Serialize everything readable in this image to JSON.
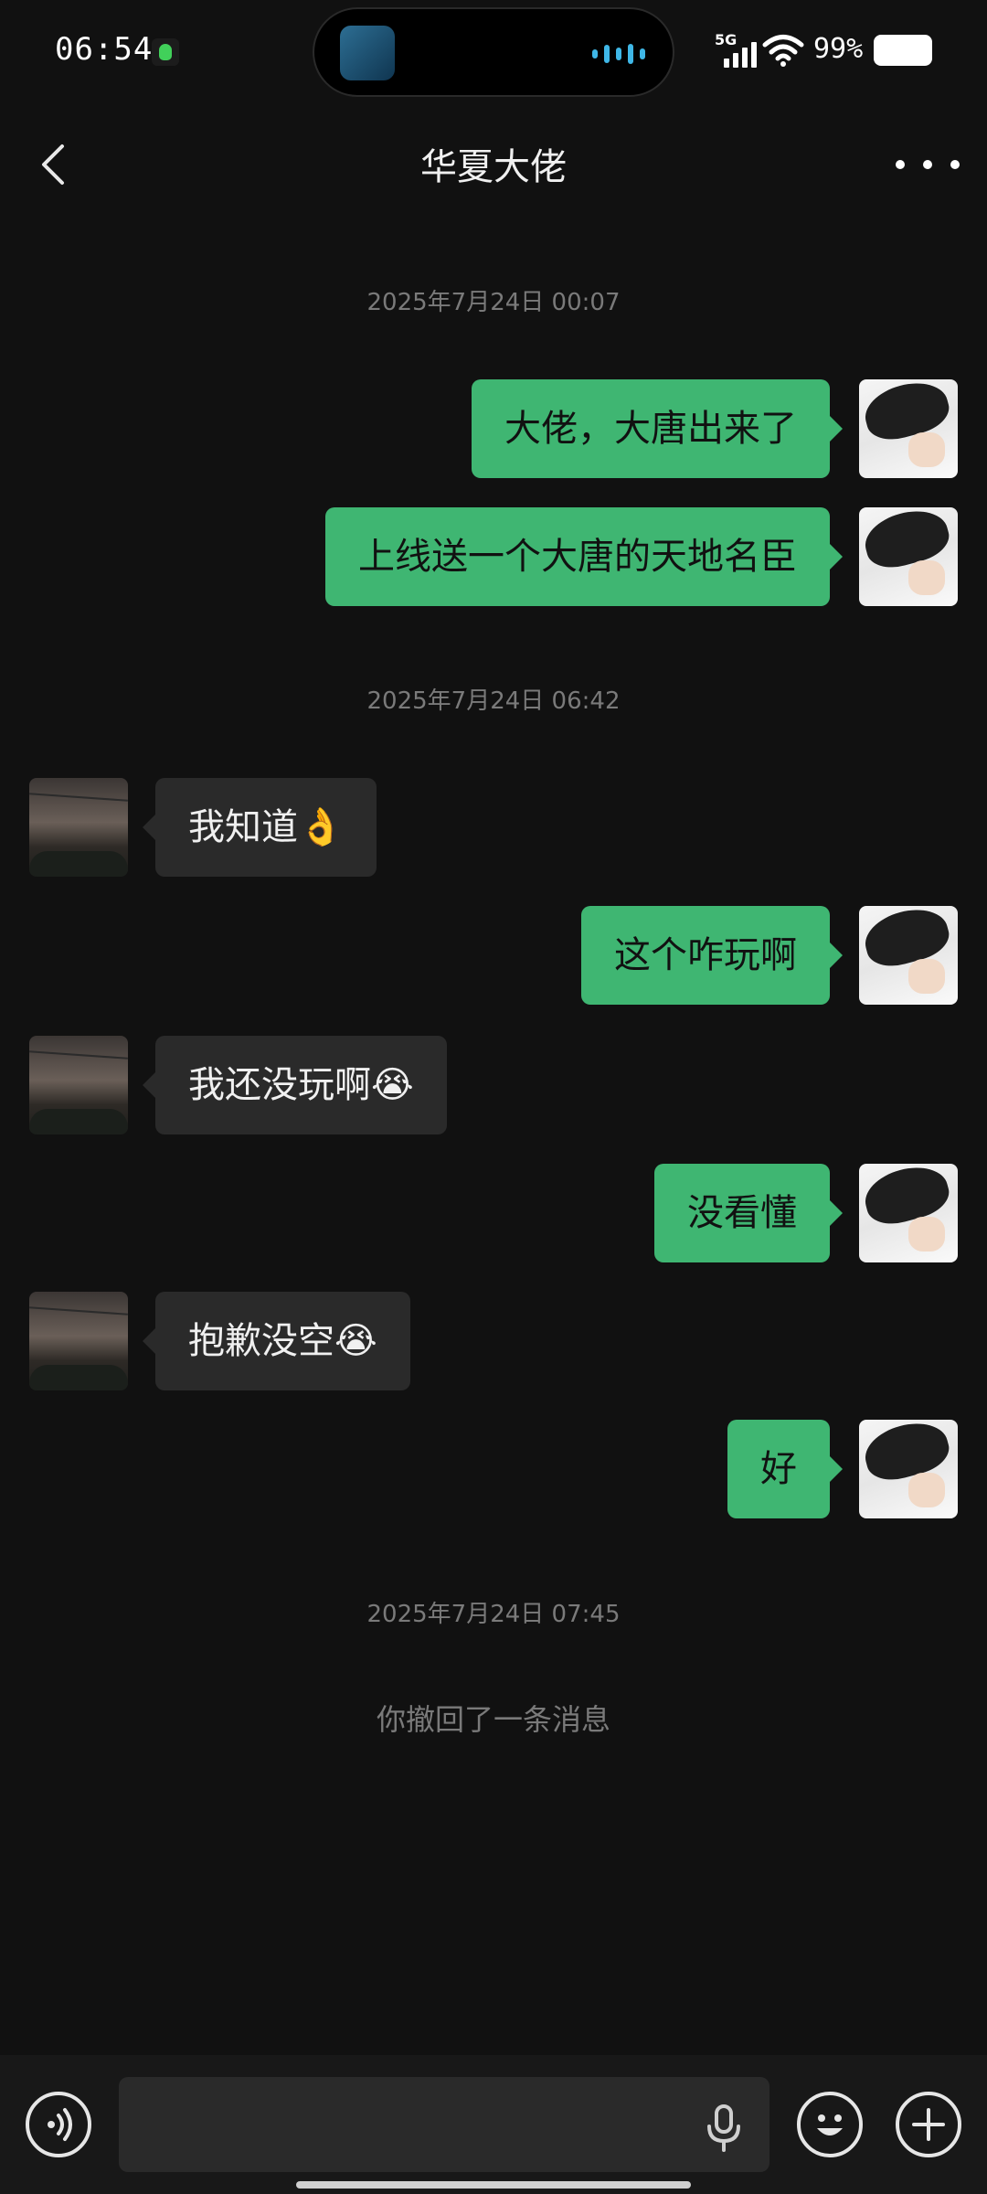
{
  "status_bar": {
    "time": "06:54",
    "network": "5G",
    "battery_percent": "99%"
  },
  "header": {
    "title": "华夏大佬"
  },
  "messages": [
    {
      "type": "timestamp",
      "text": "2025年7月24日 00:07"
    },
    {
      "type": "message",
      "from": "me",
      "text": "大佬，大唐出来了"
    },
    {
      "type": "message",
      "from": "me",
      "text": "上线送一个大唐的天地名臣"
    },
    {
      "type": "timestamp",
      "text": "2025年7月24日 06:42"
    },
    {
      "type": "message",
      "from": "peer",
      "text": "我知道👌"
    },
    {
      "type": "message",
      "from": "me",
      "text": "这个咋玩啊"
    },
    {
      "type": "message",
      "from": "peer",
      "text": "我还没玩啊😭"
    },
    {
      "type": "message",
      "from": "me",
      "text": "没看懂"
    },
    {
      "type": "message",
      "from": "peer",
      "text": "抱歉没空😭"
    },
    {
      "type": "message",
      "from": "me",
      "text": "好"
    },
    {
      "type": "timestamp",
      "text": "2025年7月24日 07:45"
    },
    {
      "type": "system",
      "text": "你撤回了一条消息"
    }
  ],
  "input_bar": {
    "placeholder": "",
    "value": ""
  },
  "colors": {
    "background": "#111111",
    "my_bubble": "#3fb672",
    "peer_bubble": "#2a2a2a",
    "timestamp_text": "#7a7a7a"
  },
  "icons": [
    "back-arrow-icon",
    "more-icon",
    "voice-mode-icon",
    "mic-icon",
    "emoji-icon",
    "plus-icon",
    "signal-icon",
    "wifi-icon",
    "battery-icon"
  ]
}
